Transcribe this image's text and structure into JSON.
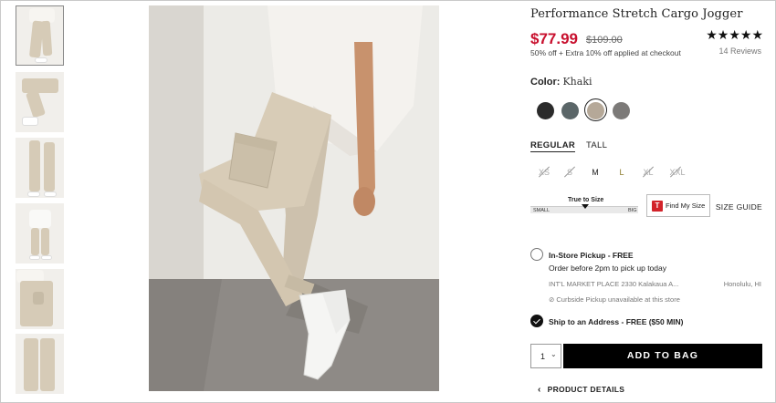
{
  "product": {
    "title": "Performance Stretch Cargo Jogger",
    "price": "$77.99",
    "original_price": "$109.00",
    "promo": "50% off + Extra 10% off applied at checkout",
    "rating_stars": "★★★★★",
    "reviews": "14 Reviews"
  },
  "color": {
    "label": "Color:",
    "selected": "Khaki",
    "swatches": [
      {
        "name": "black",
        "hex": "#2b2b2b"
      },
      {
        "name": "slate",
        "hex": "#5b6668"
      },
      {
        "name": "khaki",
        "hex": "#b5a898"
      },
      {
        "name": "grey",
        "hex": "#7c7a78"
      }
    ]
  },
  "fit": {
    "tabs": [
      "REGULAR",
      "TALL"
    ],
    "active": "REGULAR"
  },
  "sizes": [
    {
      "label": "XS",
      "available": false
    },
    {
      "label": "S",
      "available": false
    },
    {
      "label": "M",
      "available": true
    },
    {
      "label": "L",
      "available": true
    },
    {
      "label": "XL",
      "available": false
    },
    {
      "label": "XXL",
      "available": false
    }
  ],
  "fit_scale": {
    "label": "True to Size",
    "left": "SMALL",
    "right": "BIG"
  },
  "find_my_size": {
    "icon": "T",
    "label": "Find My Size"
  },
  "size_guide": "SIZE GUIDE",
  "pickup": {
    "title": "In-Store Pickup - FREE",
    "subtitle": "Order before 2pm to pick up today",
    "store_address": "INT'L MARKET PLACE 2330 Kalakaua A...",
    "store_city": "Honolulu, HI",
    "curbside": "⊘ Curbside Pickup unavailable at this store"
  },
  "ship": {
    "title": "Ship to an Address - FREE ($50 MIN)"
  },
  "quantity": {
    "value": "1"
  },
  "add_to_bag": "ADD TO BAG",
  "product_details": "PRODUCT DETAILS"
}
